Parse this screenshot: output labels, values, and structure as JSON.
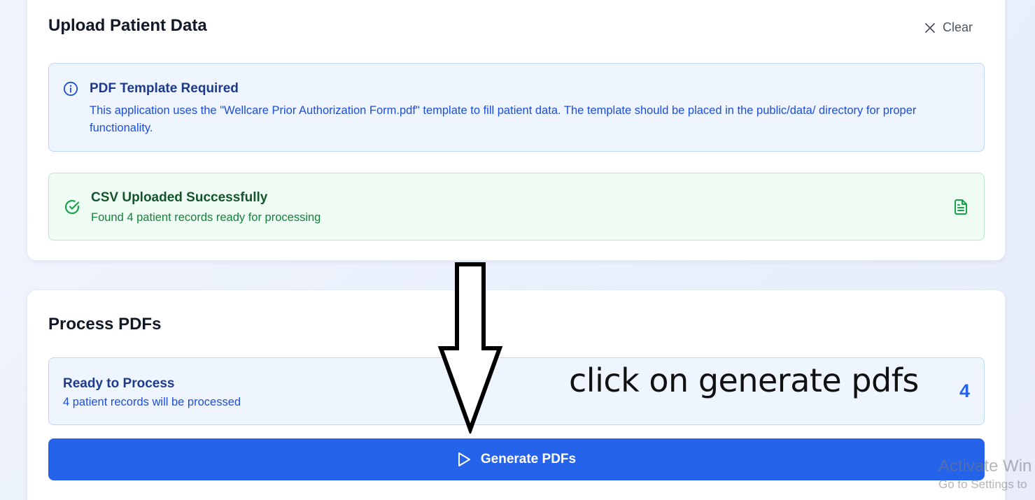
{
  "upload_section": {
    "title": "Upload Patient Data",
    "clear_label": "Clear",
    "info_alert": {
      "icon": "info-icon",
      "title": "PDF Template Required",
      "body": "This application uses the \"Wellcare Prior Authorization Form.pdf\" template to fill patient data. The template should be placed in the public/data/ directory for proper functionality."
    },
    "success_alert": {
      "icon": "check-circle-icon",
      "title": "CSV Uploaded Successfully",
      "body": "Found 4 patient records ready for processing",
      "trailing_icon": "file-text-icon"
    }
  },
  "process_section": {
    "title": "Process PDFs",
    "ready": {
      "title": "Ready to Process",
      "subtitle": "4 patient records will be processed",
      "count": "4"
    },
    "generate_button": {
      "icon": "play-icon",
      "label": "Generate PDFs"
    }
  },
  "annotation": {
    "text": "click on generate pdfs",
    "arrow": "down-arrow"
  },
  "watermark": {
    "title": "Activate Win",
    "subtitle": "Go to Settings to"
  },
  "colors": {
    "primary": "#2563eb",
    "info_bg": "#eff5ff",
    "info_border": "#bfd6f6",
    "success_bg": "#effcf3",
    "success_border": "#bbe9cb",
    "success_text": "#15803d"
  }
}
